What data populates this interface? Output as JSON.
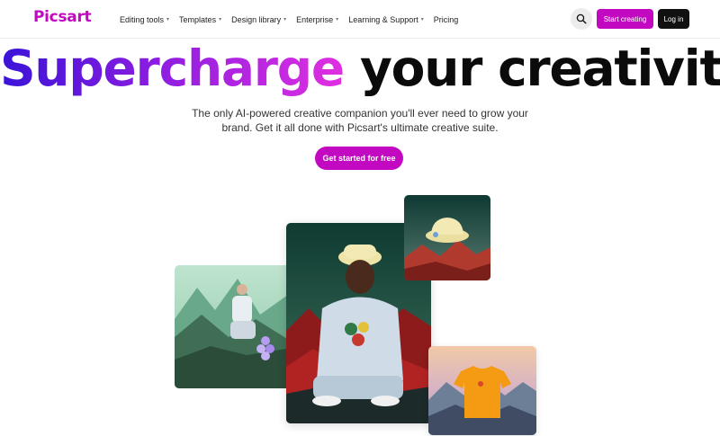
{
  "brand": {
    "logo_text": "Picsart",
    "accent_color": "#c209c1"
  },
  "nav": {
    "items": [
      {
        "label": "Editing tools",
        "has_dropdown": true
      },
      {
        "label": "Templates",
        "has_dropdown": true
      },
      {
        "label": "Design library",
        "has_dropdown": true
      },
      {
        "label": "Enterprise",
        "has_dropdown": true
      },
      {
        "label": "Learning & Support",
        "has_dropdown": true
      },
      {
        "label": "Pricing",
        "has_dropdown": false
      }
    ],
    "search_icon": "search-icon",
    "start_creating_label": "Start creating",
    "login_label": "Log in"
  },
  "hero": {
    "headline_highlight": "Supercharge",
    "headline_rest": "your creativity",
    "subtitle": "The only AI-powered creative companion you'll ever need to grow your brand. Get it all done with Picsart's ultimate creative suite.",
    "cta_label": "Get started for free"
  },
  "images": [
    {
      "name": "man-on-mountain-photo"
    },
    {
      "name": "man-in-bucket-hat-photo"
    },
    {
      "name": "bucket-hat-product-photo"
    },
    {
      "name": "orange-tshirt-product-photo"
    }
  ]
}
